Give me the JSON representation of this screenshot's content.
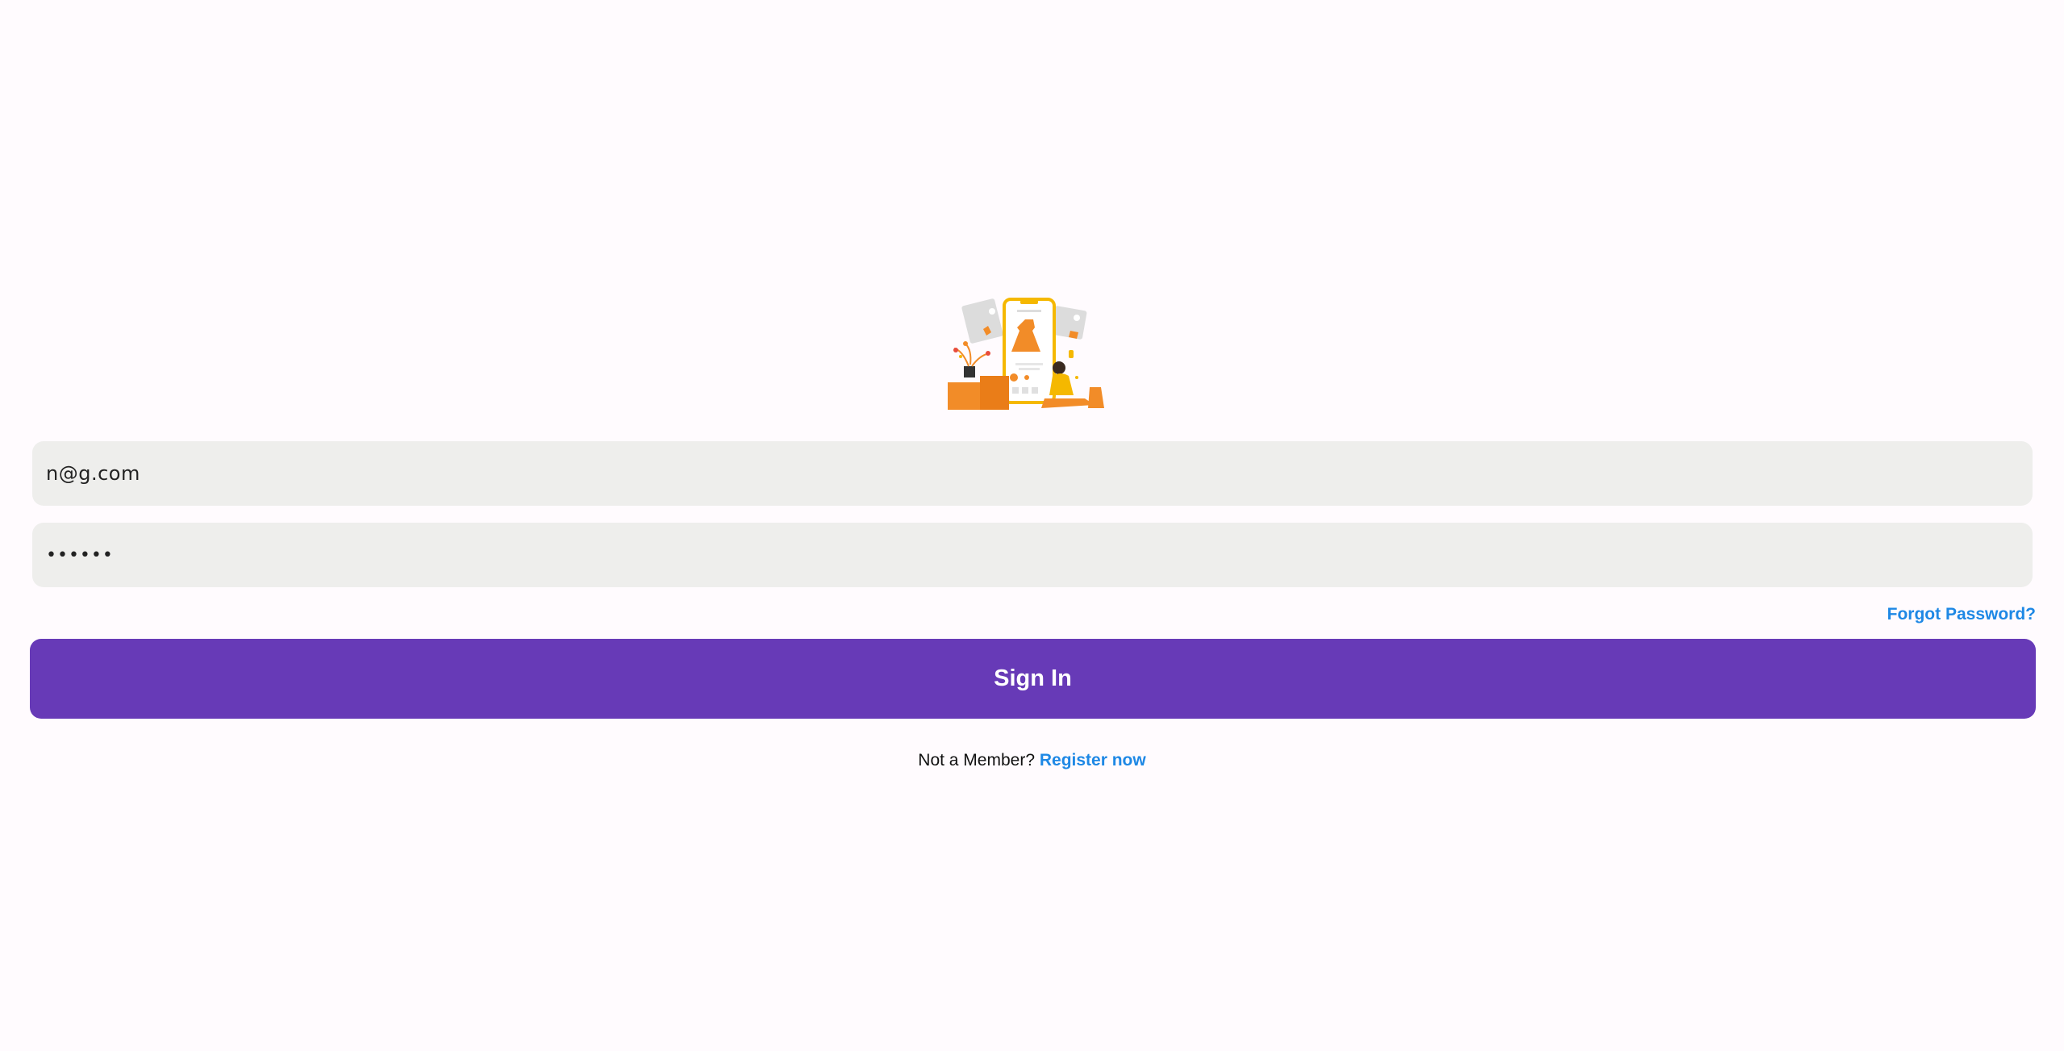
{
  "illustration": {
    "icon": "shopping-phone-illustration"
  },
  "login_form": {
    "email_value": "n@g.com",
    "password_masked": "••••••",
    "forgot_password_label": "Forgot Password?",
    "sign_in_label": "Sign In",
    "not_member_text": "Not a Member?",
    "register_label": "Register now"
  },
  "colors": {
    "background": "#fffbfe",
    "field_background": "#eeeeec",
    "primary_button": "#673ab7",
    "link": "#1e88e5"
  }
}
